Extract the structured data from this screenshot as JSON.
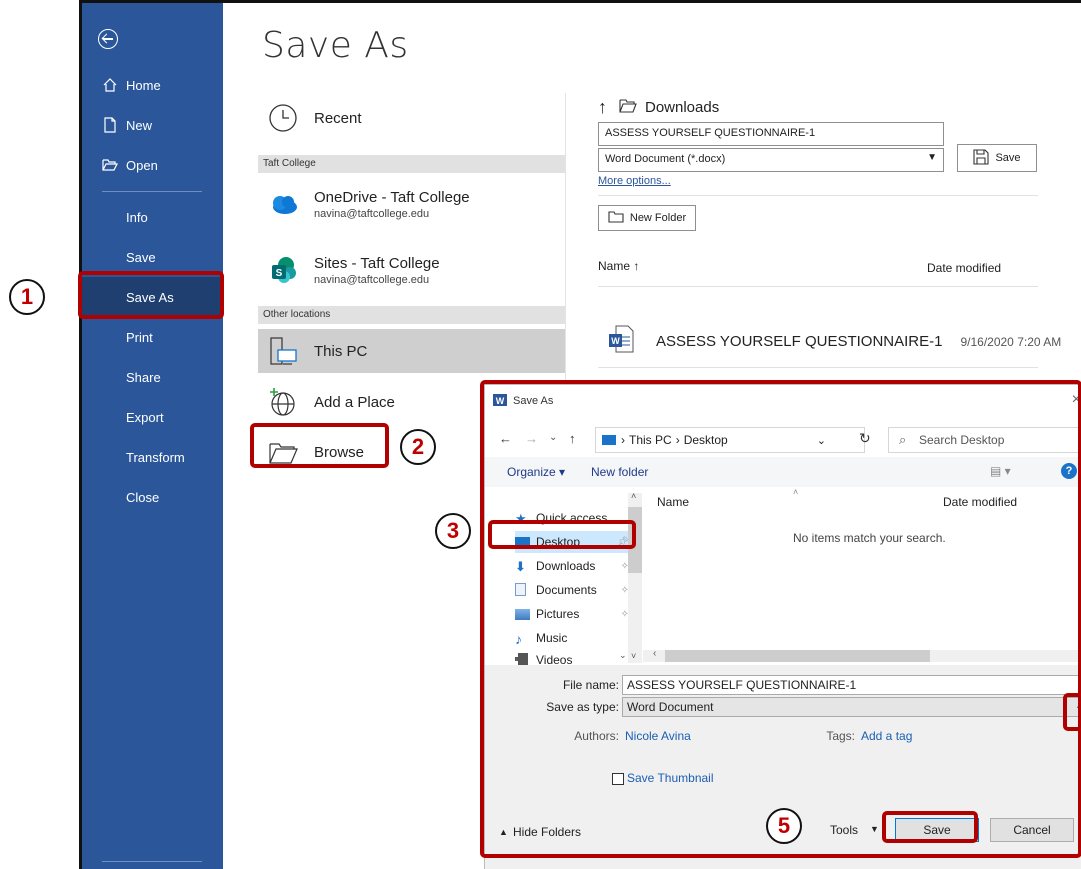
{
  "backstage": {
    "title": "Save As",
    "nav": [
      {
        "label": "Home",
        "icon": "home-icon"
      },
      {
        "label": "New",
        "icon": "new-document-icon"
      },
      {
        "label": "Open",
        "icon": "folder-open-icon"
      },
      {
        "label": "Info"
      },
      {
        "label": "Save"
      },
      {
        "label": "Save As",
        "active": true
      },
      {
        "label": "Print"
      },
      {
        "label": "Share"
      },
      {
        "label": "Export"
      },
      {
        "label": "Transform"
      },
      {
        "label": "Close"
      }
    ],
    "locations": {
      "recent": "Recent",
      "group1": "Taft College",
      "onedrive": {
        "title": "OneDrive - Taft College",
        "sub": "navina@taftcollege.edu"
      },
      "sites": {
        "title": "Sites - Taft College",
        "sub": "navina@taftcollege.edu"
      },
      "group2": "Other locations",
      "thispc": "This PC",
      "addplace": "Add a Place",
      "browse": "Browse"
    },
    "right": {
      "folder": "Downloads",
      "filename": "ASSESS YOURSELF QUESTIONNAIRE-1",
      "filetype": "Word Document (*.docx)",
      "save": "Save",
      "more_options": "More options...",
      "new_folder": "New Folder",
      "col_name": "Name ↑",
      "col_date": "Date modified",
      "file": {
        "name": "ASSESS YOURSELF QUESTIONNAIRE-1",
        "date": "9/16/2020 7:20 AM"
      }
    }
  },
  "dialog": {
    "title": "Save As",
    "path": [
      "This PC",
      "Desktop"
    ],
    "search_placeholder": "Search Desktop",
    "organize": "Organize ▾",
    "new_folder": "New folder",
    "tree": [
      {
        "label": "Quick access",
        "icon": "star-icon"
      },
      {
        "label": "Desktop",
        "icon": "desktop-icon",
        "selected": true
      },
      {
        "label": "Downloads",
        "icon": "download-icon"
      },
      {
        "label": "Documents",
        "icon": "documents-icon"
      },
      {
        "label": "Pictures",
        "icon": "pictures-icon"
      },
      {
        "label": "Music",
        "icon": "music-icon"
      },
      {
        "label": "Videos",
        "icon": "videos-icon"
      }
    ],
    "col_name": "Name",
    "col_date": "Date modified",
    "empty": "No items match your search.",
    "filename_label": "File name:",
    "filename": "ASSESS YOURSELF QUESTIONNAIRE-1",
    "type_label": "Save as type:",
    "type": "Word Document",
    "authors_label": "Authors:",
    "authors": "Nicole Avina",
    "tags_label": "Tags:",
    "tags": "Add a tag",
    "thumbnail": "Save Thumbnail",
    "hide_folders": "Hide Folders",
    "tools": "Tools",
    "save": "Save",
    "cancel": "Cancel"
  },
  "callouts": [
    "1",
    "2",
    "3",
    "5"
  ],
  "colors": {
    "nav_bg": "#2b579a",
    "nav_active": "#1f3f70",
    "highlight": "#b00000"
  }
}
